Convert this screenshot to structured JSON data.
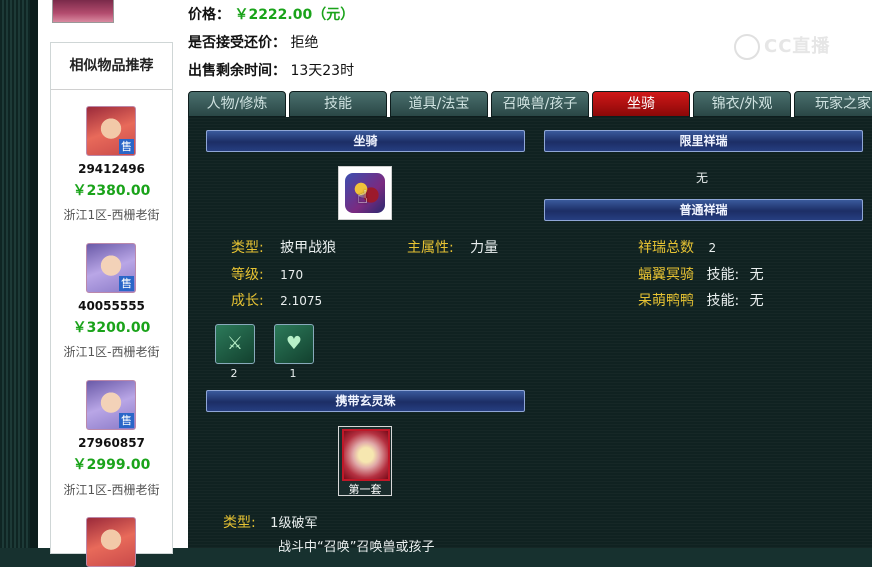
{
  "header": {
    "price_label": "价格：",
    "price_value": "￥2222.00（元）",
    "bargain_label": "是否接受还价：",
    "bargain_value": "拒绝",
    "time_label": "出售剩余时间：",
    "time_value": "13天23时"
  },
  "watermark": {
    "text": "CC直播"
  },
  "sidebar": {
    "title": "相似物品推荐",
    "badge": "售",
    "items": [
      {
        "id": "29412496",
        "price": "￥2380.00",
        "server": "浙江1区-西栅老街"
      },
      {
        "id": "40055555",
        "price": "￥3200.00",
        "server": "浙江1区-西栅老街"
      },
      {
        "id": "27960857",
        "price": "￥2999.00",
        "server": "浙江1区-西栅老街"
      }
    ]
  },
  "tabs": [
    {
      "label": "人物/修炼"
    },
    {
      "label": "技能"
    },
    {
      "label": "道具/法宝"
    },
    {
      "label": "召唤兽/孩子"
    },
    {
      "label": "坐骑"
    },
    {
      "label": "锦衣/外观"
    },
    {
      "label": "玩家之家"
    }
  ],
  "mount": {
    "section_title": "坐骑",
    "type_label": "类型:",
    "type_value": "披甲战狼",
    "main_attr_label": "主属性:",
    "main_attr_value": "力量",
    "level_label": "等级:",
    "level_value": "170",
    "growth_label": "成长:",
    "growth_value": "2.1075",
    "skills": [
      {
        "icon": "mount-skill-icon",
        "count": "2"
      },
      {
        "icon": "shield-skill-icon",
        "count": "1"
      }
    ]
  },
  "limited_xiangrui": {
    "section_title": "限里祥瑞",
    "value": "无"
  },
  "normal_xiangrui": {
    "section_title": "普通祥瑞",
    "total_label": "祥瑞总数",
    "total_value": "2",
    "items": [
      {
        "name": "蝠翼冥骑",
        "skill_label": "技能:",
        "skill_value": "无"
      },
      {
        "name": "呆萌鸭鸭",
        "skill_label": "技能:",
        "skill_value": "无"
      }
    ]
  },
  "orb": {
    "section_title": "携带玄灵珠",
    "set_label": "第一套",
    "type_label": "类型:",
    "type_value": "1级破军",
    "desc": "战斗中“召唤”召唤兽或孩子"
  },
  "colors": {
    "price_green": "#1aa31a",
    "tab_active": "#c01010",
    "label_yellow": "#e6c233",
    "section_blue": "#2a4488"
  }
}
